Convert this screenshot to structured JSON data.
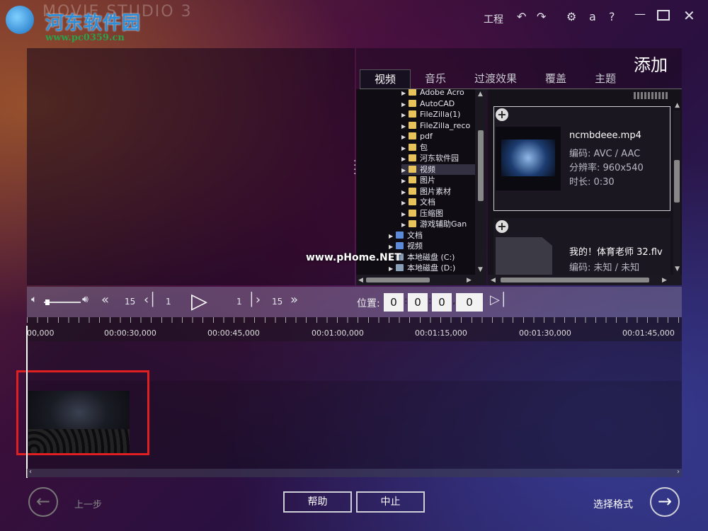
{
  "branding": {
    "site_name": "河东软件园",
    "site_url": "www.pc0359.cn",
    "app_name": "MOVIE STUDIO 3"
  },
  "titlebar": {
    "project_label": "工程",
    "undo_icon": "undo-icon",
    "redo_icon": "redo-icon",
    "settings_icon": "gear-icon",
    "font_icon": "a",
    "help_label": "?",
    "minimize_icon": "minimize-icon",
    "maximize_icon": "maximize-icon",
    "close_icon": "close-icon"
  },
  "add_panel": {
    "title": "添加",
    "tabs": [
      {
        "label": "视频",
        "active": true
      },
      {
        "label": "音乐",
        "active": false
      },
      {
        "label": "过渡效果",
        "active": false
      },
      {
        "label": "覆盖",
        "active": false
      },
      {
        "label": "主题",
        "active": false
      }
    ],
    "tree": [
      {
        "label": "Adobe Acro",
        "icon": "folder"
      },
      {
        "label": "AutoCAD",
        "icon": "folder"
      },
      {
        "label": "FileZilla(1)",
        "icon": "folder"
      },
      {
        "label": "FileZilla_reco",
        "icon": "folder"
      },
      {
        "label": "pdf",
        "icon": "folder"
      },
      {
        "label": "包",
        "icon": "folder"
      },
      {
        "label": "河东软件园",
        "icon": "folder"
      },
      {
        "label": "视频",
        "icon": "folder",
        "selected": true
      },
      {
        "label": "图片",
        "icon": "folder"
      },
      {
        "label": "图片素材",
        "icon": "folder"
      },
      {
        "label": "文档",
        "icon": "folder"
      },
      {
        "label": "压缩图",
        "icon": "folder"
      },
      {
        "label": "游戏辅助Gan",
        "icon": "folder"
      },
      {
        "label": "文档",
        "icon": "doc"
      },
      {
        "label": "视频",
        "icon": "doc"
      },
      {
        "label": "本地磁盘 (C:)",
        "icon": "drive"
      },
      {
        "label": "本地磁盘 (D:)",
        "icon": "drive"
      }
    ],
    "files": [
      {
        "name": "ncmbdeee.mp4",
        "codec": "编码: AVC / AAC",
        "resolution": "分辨率: 960x540",
        "duration": "时长: 0:30"
      },
      {
        "name": "我的！体育老师 32.flv",
        "codec": "编码: 未知 / 未知"
      }
    ]
  },
  "watermark": "www.pHome.NET",
  "transport": {
    "step_back_big": "15",
    "step_back_small": "1",
    "step_fwd_small": "1",
    "step_fwd_big": "15",
    "position_label": "位置:",
    "position": [
      "0",
      "0",
      "0",
      "0"
    ],
    "volume": 0.05
  },
  "timeline": {
    "ticks": [
      "00,000",
      "00:00:30,000",
      "00:00:45,000",
      "00:01:00,000",
      "00:01:15,000",
      "00:01:30,000",
      "00:01:45,000"
    ]
  },
  "bottom": {
    "back_label": "上一步",
    "help_label": "帮助",
    "stop_label": "中止",
    "next_label": "选择格式"
  }
}
